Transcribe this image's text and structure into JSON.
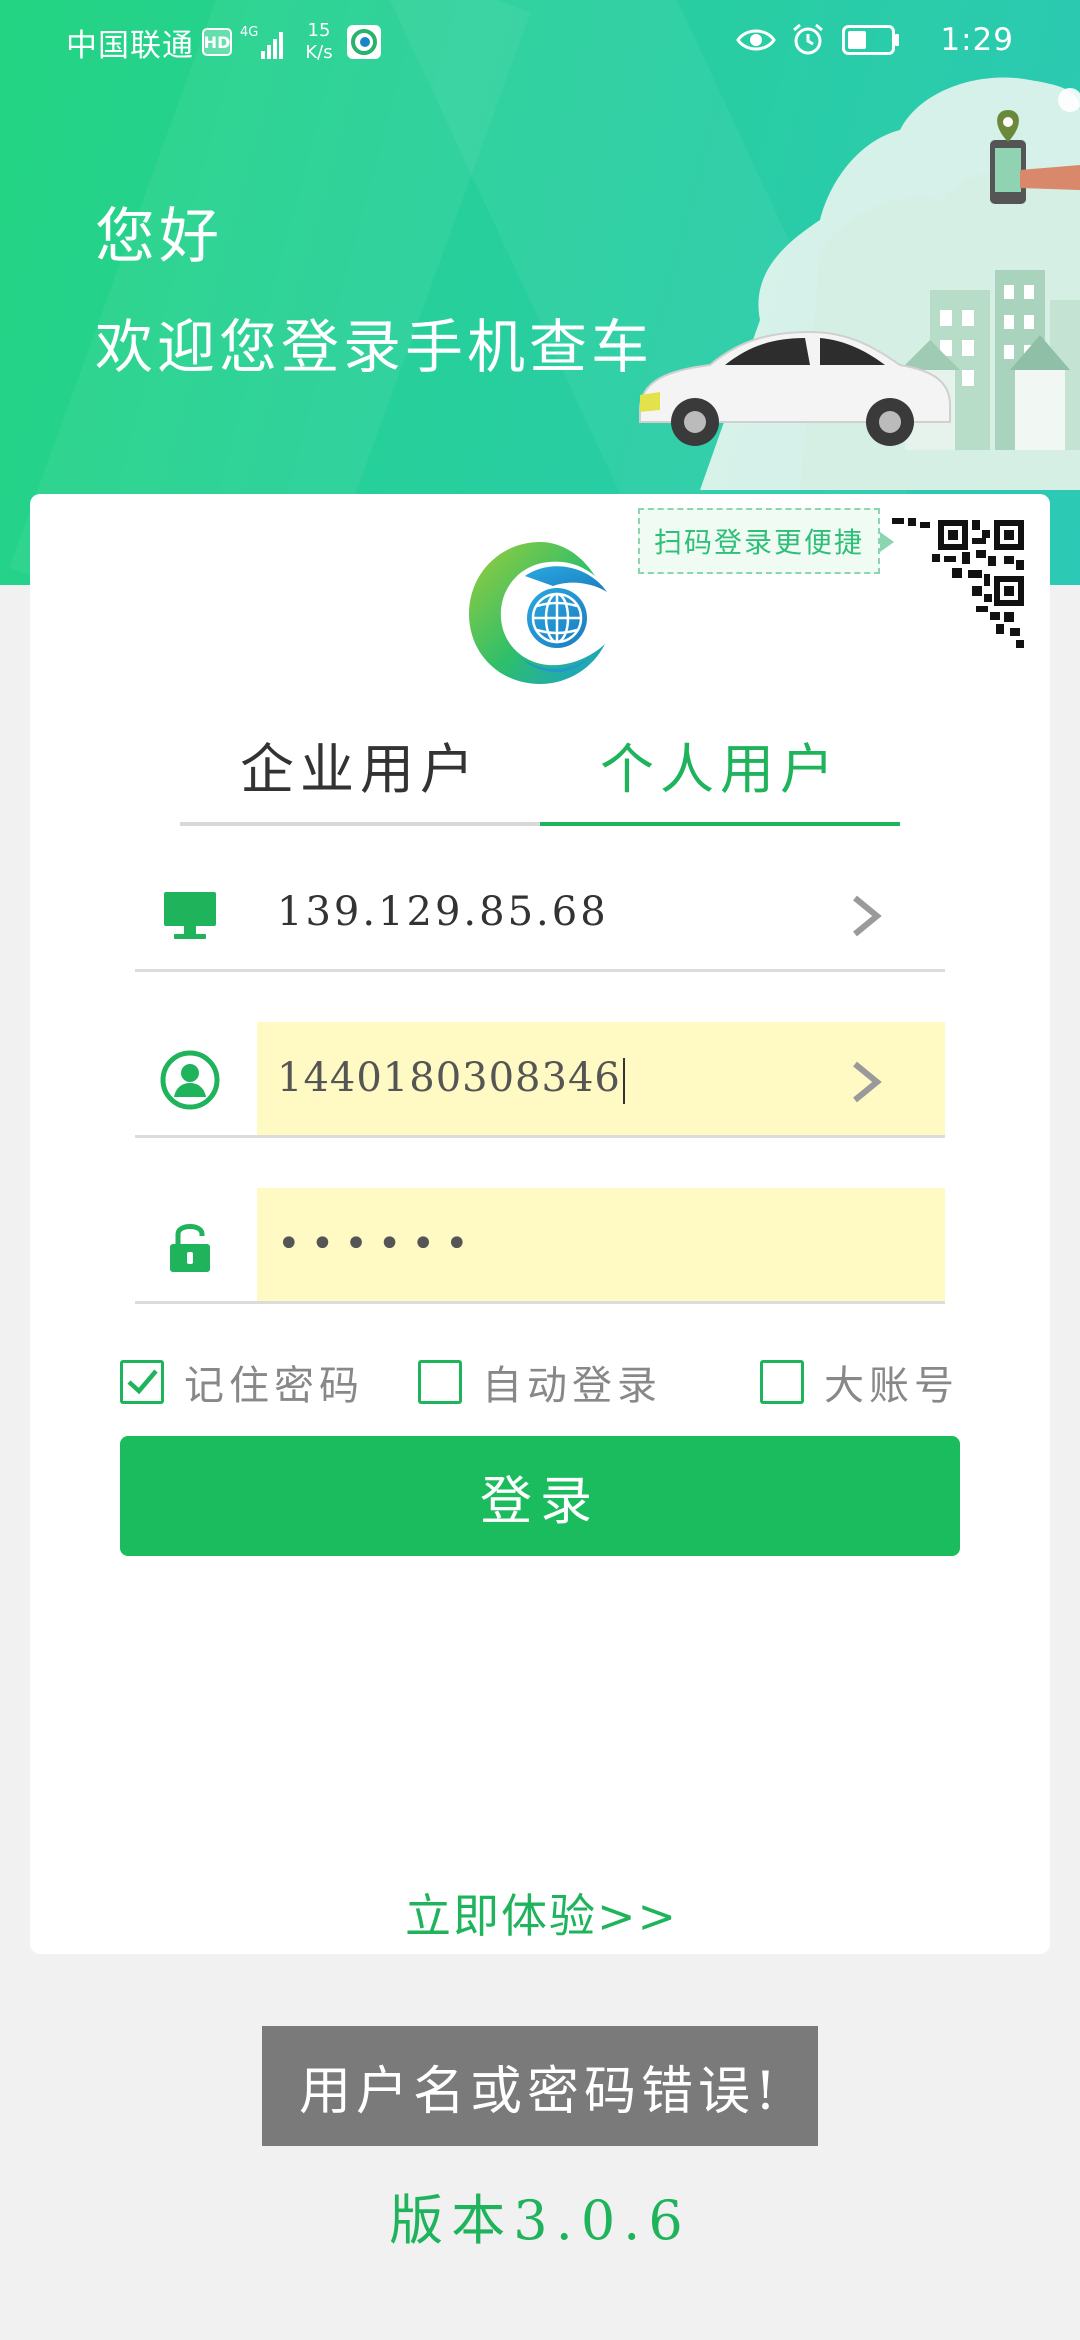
{
  "status_bar": {
    "carrier": "中国联通",
    "hd_badge": "HD",
    "network_type": "4G",
    "net_speed_value": "15",
    "net_speed_unit": "K/s",
    "time": "1:29",
    "icons": [
      "signal-icon",
      "app-logo-icon",
      "eye-icon",
      "alarm-icon",
      "battery-icon"
    ]
  },
  "header": {
    "greeting": "您好",
    "welcome": "欢迎您登录手机查车"
  },
  "qr": {
    "hint": "扫码登录更便捷"
  },
  "tabs": [
    {
      "label": "企业用户",
      "active": false
    },
    {
      "label": "个人用户",
      "active": true
    }
  ],
  "form": {
    "server_value": "139.129.85.68",
    "account_value": "1440180308346",
    "password_masked": "••••••"
  },
  "options": {
    "remember_label": "记住密码",
    "remember_checked": true,
    "auto_login_label": "自动登录",
    "auto_login_checked": false,
    "big_account_label": "大账号",
    "big_account_checked": false
  },
  "actions": {
    "login_label": "登录",
    "try_now_label": "立即体验>>"
  },
  "toast": {
    "message": "用户名或密码错误!"
  },
  "footer": {
    "version": "版本3.0.6"
  },
  "colors": {
    "brand_green": "#1bbc5e",
    "header_gradient_start": "#23d482",
    "header_gradient_end": "#2cc9b6",
    "field_highlight": "#fff9c4",
    "toast_bg": "#7a7a7a"
  }
}
